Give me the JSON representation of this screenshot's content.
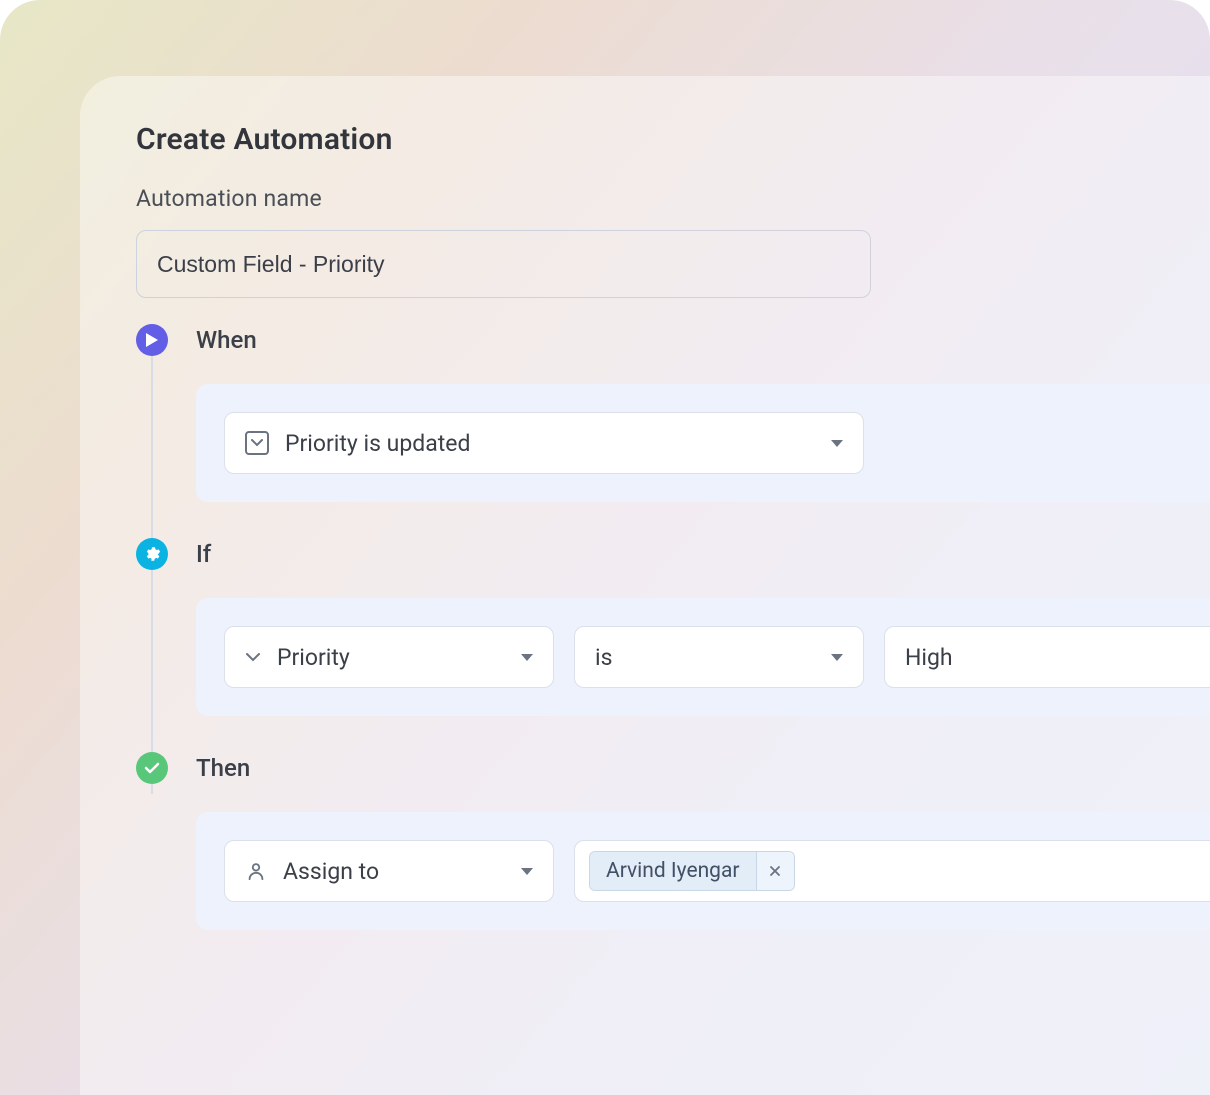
{
  "header": {
    "title": "Create Automation",
    "name_label": "Automation name",
    "name_value": "Custom Field - Priority"
  },
  "steps": {
    "when": {
      "label": "When",
      "trigger": "Priority is updated"
    },
    "if": {
      "label": "If",
      "field": "Priority",
      "operator": "is",
      "value": "High"
    },
    "then": {
      "label": "Then",
      "action": "Assign to",
      "assignee": "Arvind Iyengar"
    }
  }
}
